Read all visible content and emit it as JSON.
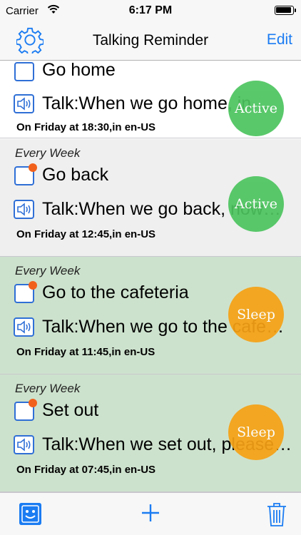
{
  "status_bar": {
    "carrier": "Carrier",
    "time": "6:17 PM",
    "wifi_icon": "wifi-icon",
    "battery_icon": "battery-icon"
  },
  "nav": {
    "title": "Talking Reminder",
    "edit_label": "Edit",
    "settings_icon": "gear-icon"
  },
  "reminders": [
    {
      "frequency": "",
      "name": "Go home",
      "talk": "Talk:When we go home, in…",
      "schedule": "On Friday at 18:30,in en-US",
      "status": "Active"
    },
    {
      "frequency": "Every Week",
      "name": "Go back",
      "talk": "Talk:When we go back, now…",
      "schedule": "On Friday at 12:45,in en-US",
      "status": "Active"
    },
    {
      "frequency": "Every Week",
      "name": "Go to the cafeteria",
      "talk": "Talk:When we go to the cafe…",
      "schedule": "On Friday at 11:45,in en-US",
      "status": "Sleep"
    },
    {
      "frequency": "Every Week",
      "name": "Set out",
      "talk": "Talk:When we set out, please…",
      "schedule": "On Friday at 07:45,in en-US",
      "status": "Sleep"
    }
  ],
  "toolbar": {
    "left_icon": "smiley-icon",
    "add_icon": "plus-icon",
    "delete_icon": "trash-icon"
  },
  "colors": {
    "tint": "#1b7cf2",
    "active": "#4cc45e",
    "sleep": "#f6a114",
    "sleep_row": "#cde2cd",
    "checkbox_dot": "#f2611c"
  }
}
